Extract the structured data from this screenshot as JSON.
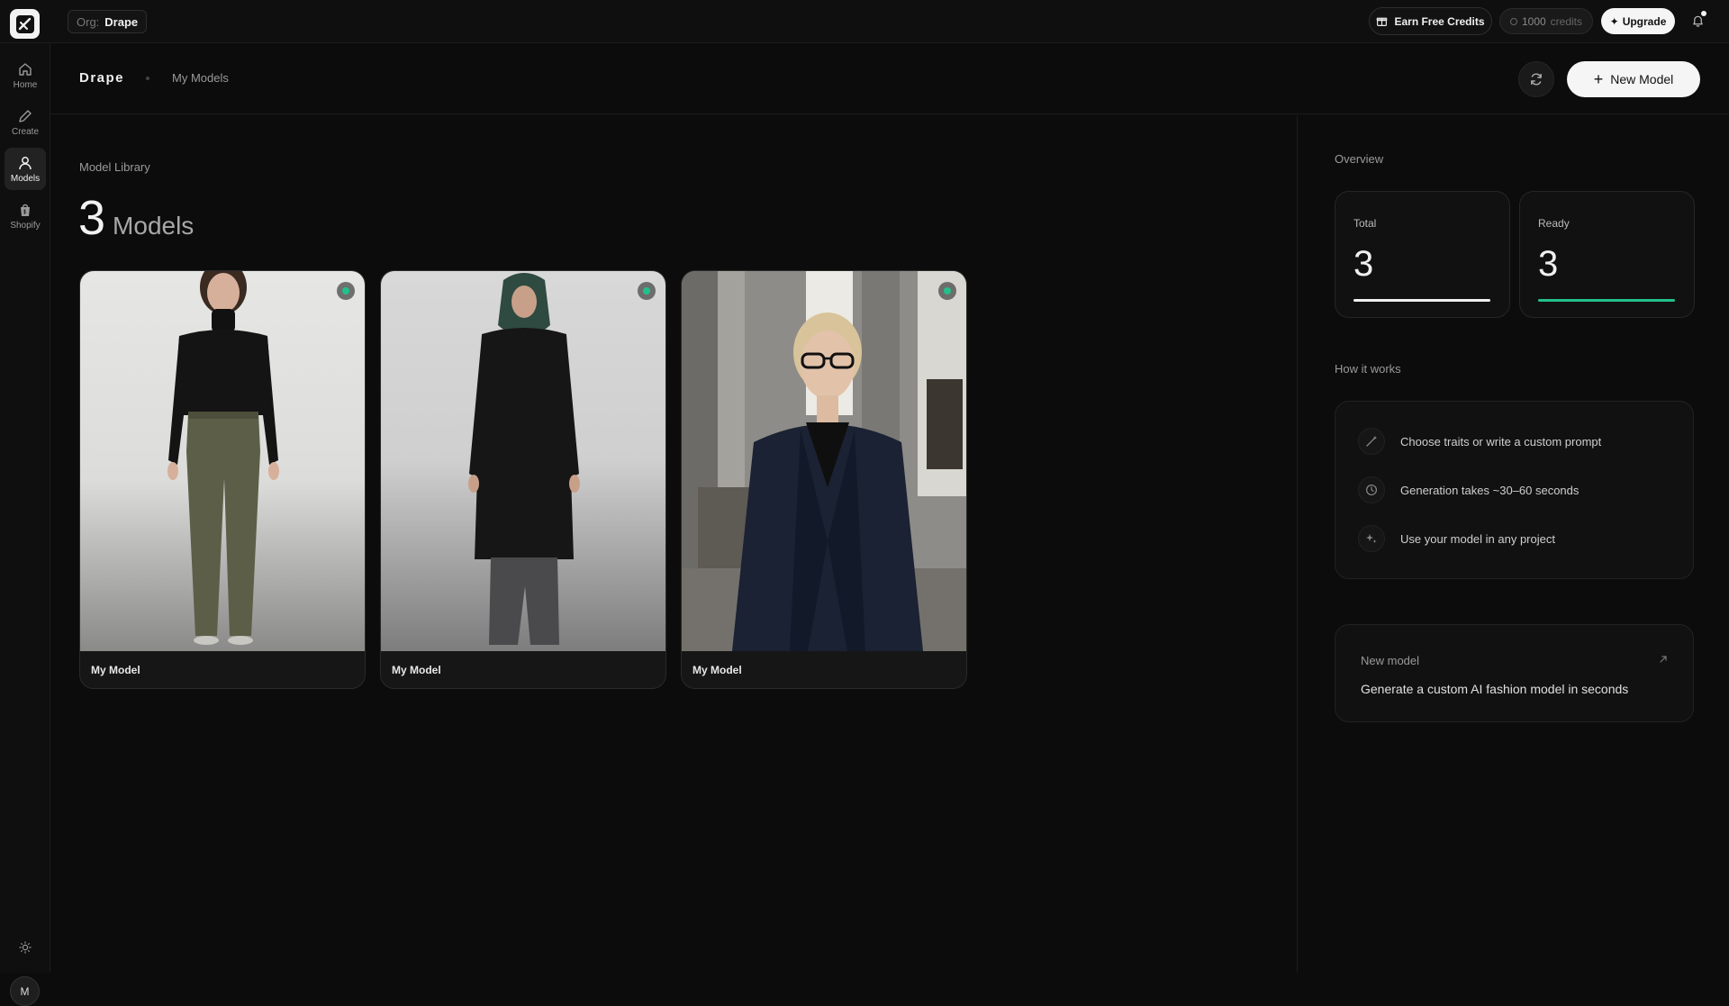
{
  "topbar": {
    "org_key": "Org:",
    "org_value": "Drape",
    "earn_label": "Earn Free Credits",
    "credits_amount": "1000",
    "credits_label": "credits",
    "upgrade_label": "Upgrade",
    "upgrade_icon": "sparkle-icon"
  },
  "sidebar": {
    "items": [
      {
        "label": "Home",
        "icon": "home-icon"
      },
      {
        "label": "Create",
        "icon": "pencil-icon"
      },
      {
        "label": "Models",
        "icon": "user-icon"
      },
      {
        "label": "Shopify",
        "icon": "shopify-icon"
      }
    ],
    "active": "Models",
    "avatar_initial": "M"
  },
  "header": {
    "brand": "Drape",
    "breadcrumb": "My Models",
    "new_model_label": "New Model"
  },
  "main": {
    "library_label": "Model Library",
    "count": "3",
    "count_word": "Models",
    "cards": [
      {
        "name": "My Model",
        "status": "ready"
      },
      {
        "name": "My Model",
        "status": "ready"
      },
      {
        "name": "My Model",
        "status": "ready"
      }
    ]
  },
  "overview": {
    "title": "Overview",
    "total_label": "Total",
    "total_value": "3",
    "ready_label": "Ready",
    "ready_value": "3",
    "ready_fraction": 1.0
  },
  "how": {
    "title": "How it works",
    "items": [
      {
        "text": "Choose traits or write a custom prompt",
        "icon": "wand-icon"
      },
      {
        "text": "Generation takes ~30–60 seconds",
        "icon": "clock-icon"
      },
      {
        "text": "Use your model in any project",
        "icon": "sparkles-icon"
      }
    ]
  },
  "cta": {
    "title": "New model",
    "text": "Generate a custom AI fashion model in seconds"
  },
  "colors": {
    "accent": "#22c08a",
    "background": "#0c0c0c"
  }
}
